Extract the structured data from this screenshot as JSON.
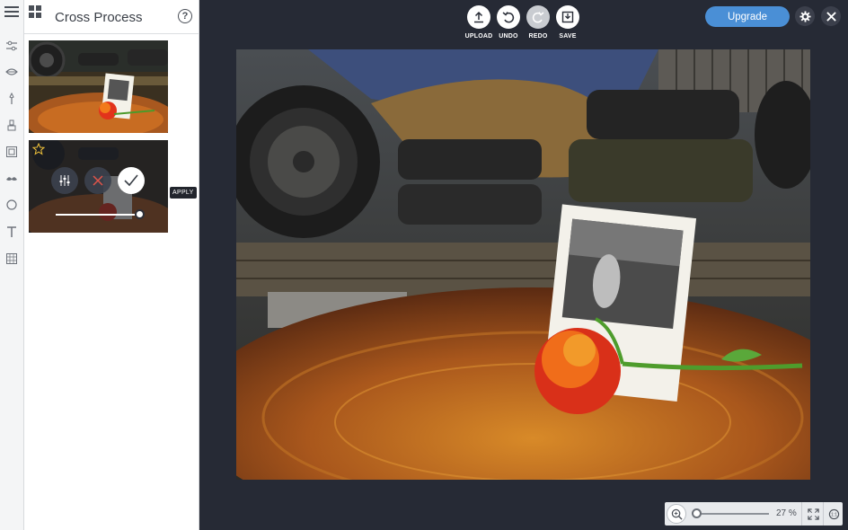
{
  "panel": {
    "title": "Cross Process",
    "help": "?"
  },
  "toolbar": {
    "upload": "UPLOAD",
    "undo": "UNDO",
    "redo": "REDO",
    "save": "SAVE"
  },
  "upgrade_label": "Upgrade",
  "filter_card": {
    "apply_tooltip": "APPLY",
    "intensity": 1.0
  },
  "zoom": {
    "value": "27 %",
    "level": 0.0
  },
  "rail_icons": [
    "sliders-icon",
    "eye-icon",
    "wand-icon",
    "brush-icon",
    "frame-icon",
    "mustache-icon",
    "circle-icon",
    "text-icon",
    "texture-icon"
  ],
  "colors": {
    "accent": "#4a8fd6",
    "canvas_bg": "#262a35",
    "panel_bg": "#ffffff"
  }
}
